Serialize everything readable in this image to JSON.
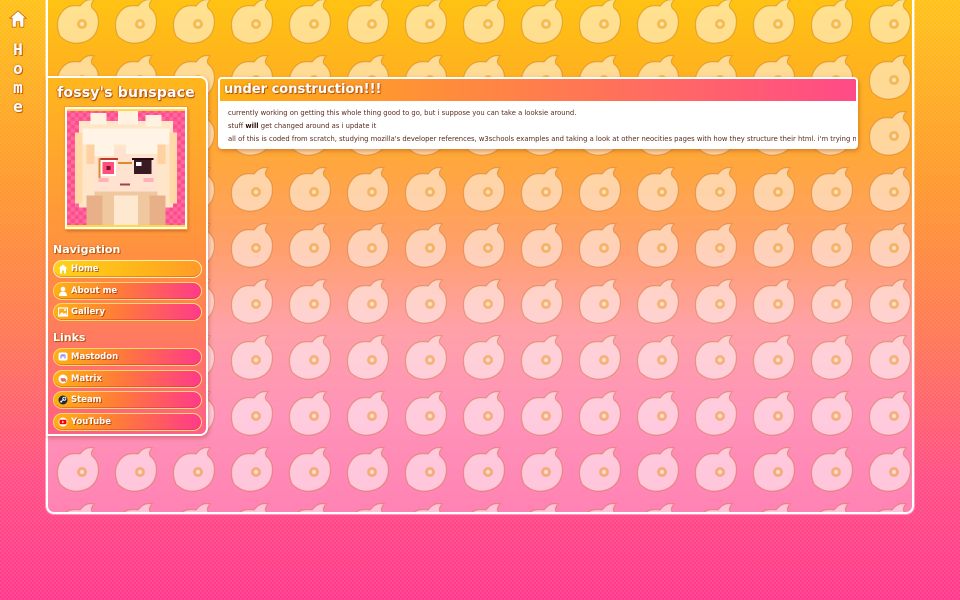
{
  "side_label": {
    "icon": "home-icon",
    "letters": [
      "H",
      "o",
      "m",
      "e"
    ]
  },
  "sidebar": {
    "title": "fossy's bunspace",
    "avatar_alt": "pixel-art avatar",
    "navigation_heading": "Navigation",
    "navigation": [
      {
        "label": "Home",
        "icon": "home-icon",
        "active": true
      },
      {
        "label": "About me",
        "icon": "person-icon",
        "active": false
      },
      {
        "label": "Gallery",
        "icon": "image-icon",
        "active": false
      }
    ],
    "links_heading": "Links",
    "links": [
      {
        "label": "Mastodon",
        "icon": "mastodon-icon"
      },
      {
        "label": "Matrix",
        "icon": "matrix-icon"
      },
      {
        "label": "Steam",
        "icon": "steam-icon"
      },
      {
        "label": "YouTube",
        "icon": "youtube-icon"
      }
    ]
  },
  "content": {
    "title": "under construction!!!",
    "line1": "currently working on getting this whole thing good to go, but i suppose you can take a looksie around.",
    "line2_prefix": "stuff ",
    "line2_bold": "will",
    "line2_suffix": " get changed around as i update it",
    "line3": "all of this is coded from scratch, studying mozilla's developer references, w3schools examples and taking a look at other neocities pages with how they structure their html. i'm trying my best"
  },
  "colors": {
    "accent_yellow": "#ffc21a",
    "accent_orange": "#ff8840",
    "accent_pink": "#ff3a8c"
  }
}
